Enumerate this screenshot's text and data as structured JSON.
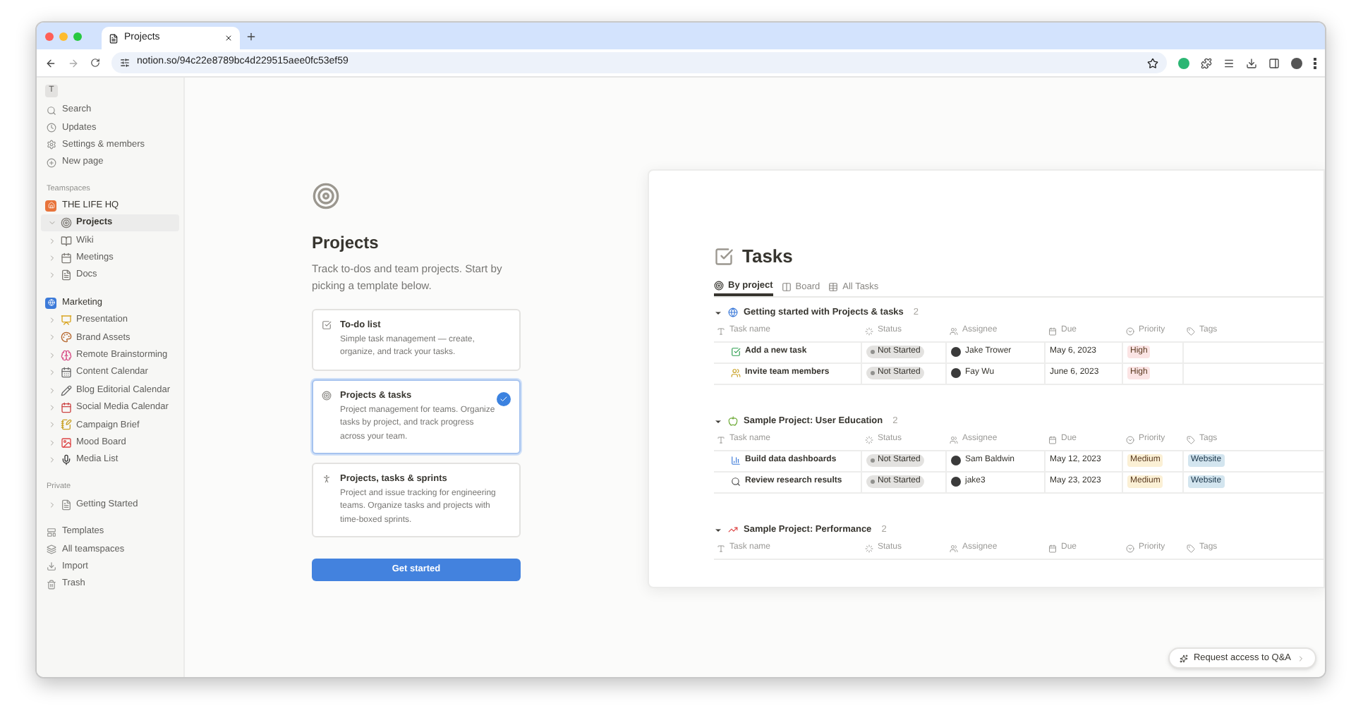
{
  "browser": {
    "tab_title": "Projects",
    "url": "notion.so/94c22e8789bc4d229515aee0fc53ef59"
  },
  "sidebar": {
    "workspace_initial": "T",
    "top_items": [
      {
        "label": "Search"
      },
      {
        "label": "Updates"
      },
      {
        "label": "Settings & members"
      },
      {
        "label": "New page"
      }
    ],
    "teamspaces_heading": "Teamspaces",
    "teamspaces": [
      {
        "name": "THE LIFE HQ",
        "pages": [
          {
            "label": "Projects",
            "selected": true
          },
          {
            "label": "Wiki",
            "selected": false
          },
          {
            "label": "Meetings",
            "selected": false
          },
          {
            "label": "Docs",
            "selected": false
          }
        ]
      },
      {
        "name": "Marketing",
        "pages": [
          {
            "label": "Presentation",
            "selected": false
          },
          {
            "label": "Brand Assets",
            "selected": false
          },
          {
            "label": "Remote Brainstorming",
            "selected": false
          },
          {
            "label": "Content Calendar",
            "selected": false
          },
          {
            "label": "Blog Editorial Calendar",
            "selected": false
          },
          {
            "label": "Social Media Calendar",
            "selected": false
          },
          {
            "label": "Campaign Brief",
            "selected": false
          },
          {
            "label": "Mood Board",
            "selected": false
          },
          {
            "label": "Media List",
            "selected": false
          }
        ]
      }
    ],
    "private_heading": "Private",
    "private_pages": [
      {
        "label": "Getting Started",
        "selected": false
      }
    ],
    "bottom_items": [
      {
        "label": "Templates"
      },
      {
        "label": "All teamspaces"
      },
      {
        "label": "Import"
      },
      {
        "label": "Trash"
      }
    ]
  },
  "setup": {
    "title": "Projects",
    "description": "Track to-dos and team projects. Start by picking a template below.",
    "templates": [
      {
        "title": "To-do list",
        "description": "Simple task management — create, organize, and track your tasks.",
        "selected": false
      },
      {
        "title": "Projects & tasks",
        "description": "Project management for teams. Organize tasks by project, and track progress across your team.",
        "selected": true
      },
      {
        "title": "Projects, tasks & sprints",
        "description": "Project and issue tracking for engineering teams. Organize tasks and projects with time-boxed sprints.",
        "selected": false
      }
    ],
    "button": "Get started"
  },
  "preview": {
    "title": "Tasks",
    "views": [
      {
        "label": "By project",
        "selected": true
      },
      {
        "label": "Board",
        "selected": false
      },
      {
        "label": "All Tasks",
        "selected": false
      }
    ],
    "groups": [
      {
        "name": "Getting started with Projects & tasks",
        "count": "2",
        "columns": [
          "Task name",
          "Status",
          "Assignee",
          "Due",
          "Priority",
          "Tags"
        ],
        "rows": [
          {
            "task": "Add a new task",
            "status": "Not Started",
            "assignee": "Jake Trower",
            "due": "May 6, 2023",
            "priority": {
              "label": "High",
              "color": "#fbe4e4"
            }
          },
          {
            "task": "Invite team members",
            "status": "Not Started",
            "assignee": "Fay Wu",
            "due": "June 6, 2023",
            "priority": {
              "label": "High",
              "color": "#fbe4e4"
            }
          }
        ]
      },
      {
        "name": "Sample Project: User Education",
        "count": "2",
        "columns": [
          "Task name",
          "Status",
          "Assignee",
          "Due",
          "Priority",
          "Tags"
        ],
        "rows": [
          {
            "task": "Build data dashboards",
            "status": "Not Started",
            "assignee": "Sam Baldwin",
            "due": "May 12, 2023",
            "priority": {
              "label": "Medium",
              "color": "#fbf0d5"
            },
            "tag": "Website"
          },
          {
            "task": "Review research results",
            "status": "Not Started",
            "assignee": "jake3",
            "due": "May 23, 2023",
            "priority": {
              "label": "Medium",
              "color": "#fbf0d5"
            },
            "tag": "Website"
          }
        ]
      },
      {
        "name": "Sample Project: Performance",
        "count": "2",
        "columns": [
          "Task name",
          "Status",
          "Assignee",
          "Due",
          "Priority",
          "Tags"
        ]
      }
    ]
  },
  "qa_button": "Request access to Q&A"
}
